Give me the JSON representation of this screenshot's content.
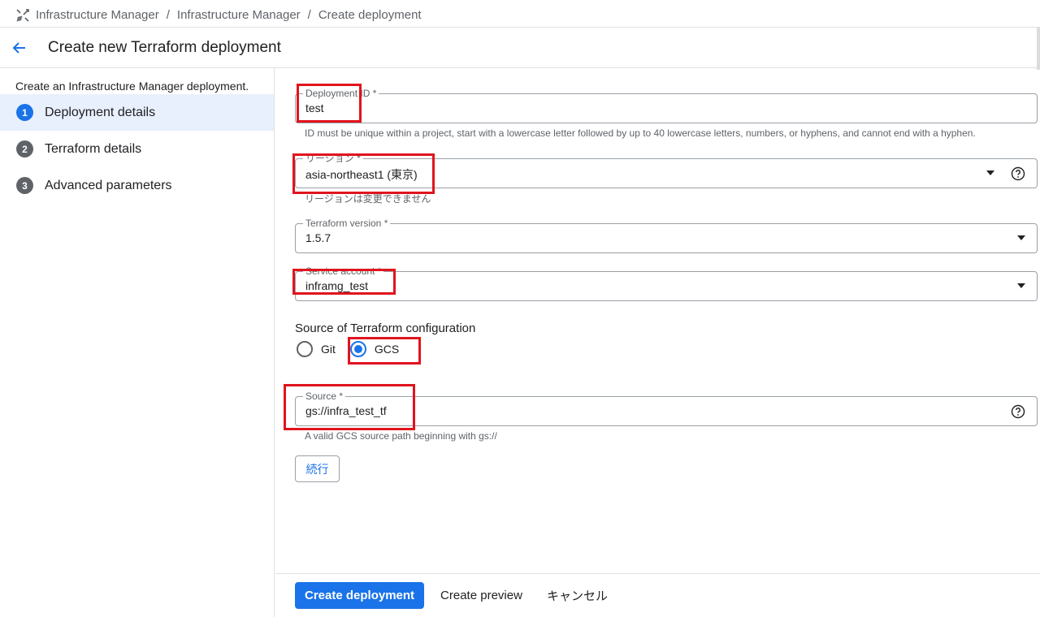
{
  "breadcrumb": {
    "items": [
      "Infrastructure Manager",
      "Infrastructure Manager",
      "Create deployment"
    ],
    "icon": "infra-manager-icon"
  },
  "header": {
    "title": "Create new Terraform deployment",
    "back_icon": "arrow-back-icon"
  },
  "sidebar": {
    "intro": "Create an Infrastructure Manager deployment.",
    "steps": [
      {
        "num": "1",
        "label": "Deployment details",
        "active": true
      },
      {
        "num": "2",
        "label": "Terraform details",
        "active": false
      },
      {
        "num": "3",
        "label": "Advanced parameters",
        "active": false
      }
    ]
  },
  "form": {
    "deployment_id": {
      "label": "Deployment ID *",
      "value": "test",
      "hint": "ID must be unique within a project, start with a lowercase letter followed by up to 40 lowercase letters, numbers, or hyphens, and cannot end with a hyphen."
    },
    "region": {
      "label": "リージョン *",
      "value": "asia-northeast1 (東京)",
      "hint": "リージョンは変更できません"
    },
    "terraform_version": {
      "label": "Terraform version *",
      "value": "1.5.7"
    },
    "service_account": {
      "label": "Service account *",
      "value": "inframg_test"
    },
    "source_config": {
      "title": "Source of Terraform configuration",
      "options": [
        {
          "label": "Git",
          "checked": false
        },
        {
          "label": "GCS",
          "checked": true
        }
      ]
    },
    "source": {
      "label": "Source *",
      "value": "gs://infra_test_tf",
      "hint": "A valid GCS source path beginning with gs://"
    },
    "continue_label": "続行"
  },
  "footer": {
    "create_label": "Create deployment",
    "preview_label": "Create preview",
    "cancel_label": "キャンセル"
  },
  "colors": {
    "accent": "#1a73e8",
    "annotation": "#e0141d"
  }
}
